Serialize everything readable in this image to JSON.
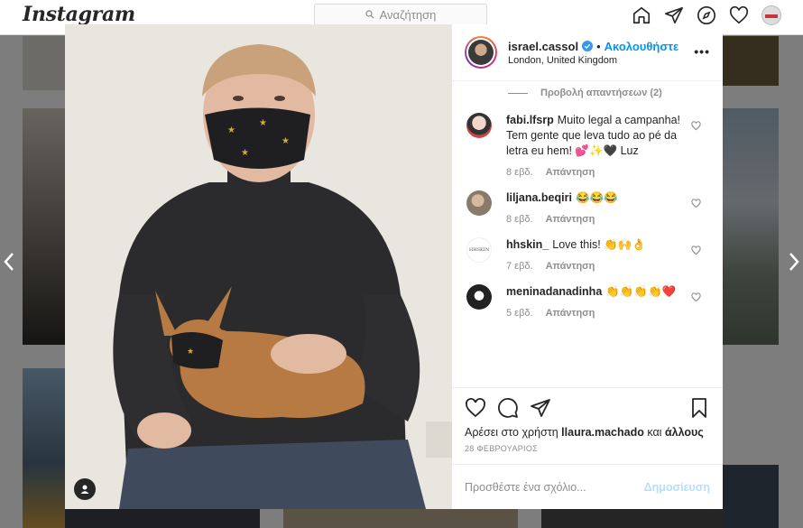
{
  "app": {
    "logo": "Instagram",
    "search_placeholder": "Αναζήτηση"
  },
  "post": {
    "username": "israel.cassol",
    "follow_label": "Ακολουθήστε",
    "location": "London, United Kingdom",
    "view_replies": "Προβολή απαντήσεων (2)",
    "comments": [
      {
        "username": "fabi.lfsrp",
        "text": "Muito legal a campanha! Tem gente que leva tudo ao pé da letra eu hem! 💕✨🖤 Luz",
        "time": "8 εβδ.",
        "reply": "Απάντηση"
      },
      {
        "username": "liljana.beqiri",
        "text": "😂😂😂",
        "time": "8 εβδ.",
        "reply": "Απάντηση"
      },
      {
        "username": "hhskin_",
        "text": "Love this! 👏🙌👌",
        "time": "7 εβδ.",
        "reply": "Απάντηση"
      },
      {
        "username": "meninadanadinha",
        "text": "👏👏👏👏❤️",
        "time": "5 εβδ.",
        "reply": "Απάντηση"
      }
    ],
    "likes_prefix": "Αρέσει στο χρήστη",
    "likes_user": "llaura.machado",
    "likes_and": "και",
    "likes_others": "άλλους",
    "date": "28 ΦΕΒΡΟΥΑΡΙΟΣ",
    "comment_placeholder": "Προσθέστε ένα σχόλιο...",
    "post_button": "Δημοσίευση",
    "hhskin_avatar_text": "HHSKIN"
  },
  "colors": {
    "accent": "#0095f6",
    "post_disabled": "#b2dffc",
    "meta": "#8e8e8e"
  }
}
